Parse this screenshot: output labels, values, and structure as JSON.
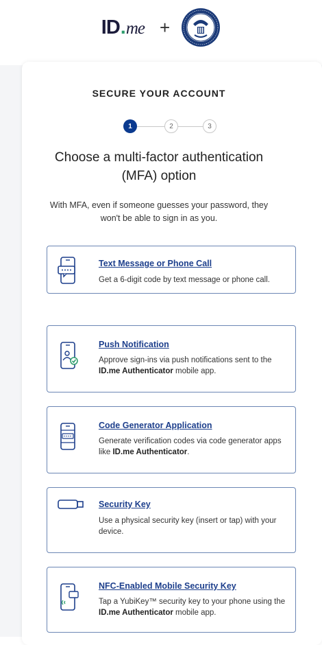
{
  "header": {
    "logo_id": "ID",
    "logo_dot": ".",
    "logo_me": "me",
    "plus": "+"
  },
  "eyebrow": "SECURE YOUR ACCOUNT",
  "steps": [
    "1",
    "2",
    "3"
  ],
  "title": "Choose a multi-factor authentication (MFA) option",
  "description": "With MFA, even if someone guesses your password, they won't be able to sign in as you.",
  "options": [
    {
      "icon": "phone-message-icon",
      "title": "Text Message or Phone Call",
      "desc_pre": "Get a 6-digit code by text message or phone call.",
      "desc_bold": "",
      "desc_post": ""
    },
    {
      "icon": "phone-push-icon",
      "title": "Push Notification",
      "desc_pre": "Approve sign-ins via push notifications sent to the ",
      "desc_bold": "ID.me Authenticator",
      "desc_post": " mobile app."
    },
    {
      "icon": "phone-code-icon",
      "title": "Code Generator Application",
      "desc_pre": "Generate verification codes via code generator apps like ",
      "desc_bold": "ID.me Authenticator",
      "desc_post": "."
    },
    {
      "icon": "security-key-icon",
      "title": "Security Key",
      "desc_pre": "Use a physical security key (insert or tap) with your device.",
      "desc_bold": "",
      "desc_post": ""
    },
    {
      "icon": "nfc-phone-icon",
      "title": "NFC-Enabled Mobile Security Key",
      "desc_pre": "Tap a YubiKey™ security key to your phone using the ",
      "desc_bold": "ID.me Authenticator",
      "desc_post": " mobile app."
    }
  ],
  "colors": {
    "accent": "#1d3f8c",
    "step_active": "#0b3a8f",
    "border": "#6b86b4",
    "icon": "#1d3f8c",
    "check": "#2f9e6e"
  }
}
